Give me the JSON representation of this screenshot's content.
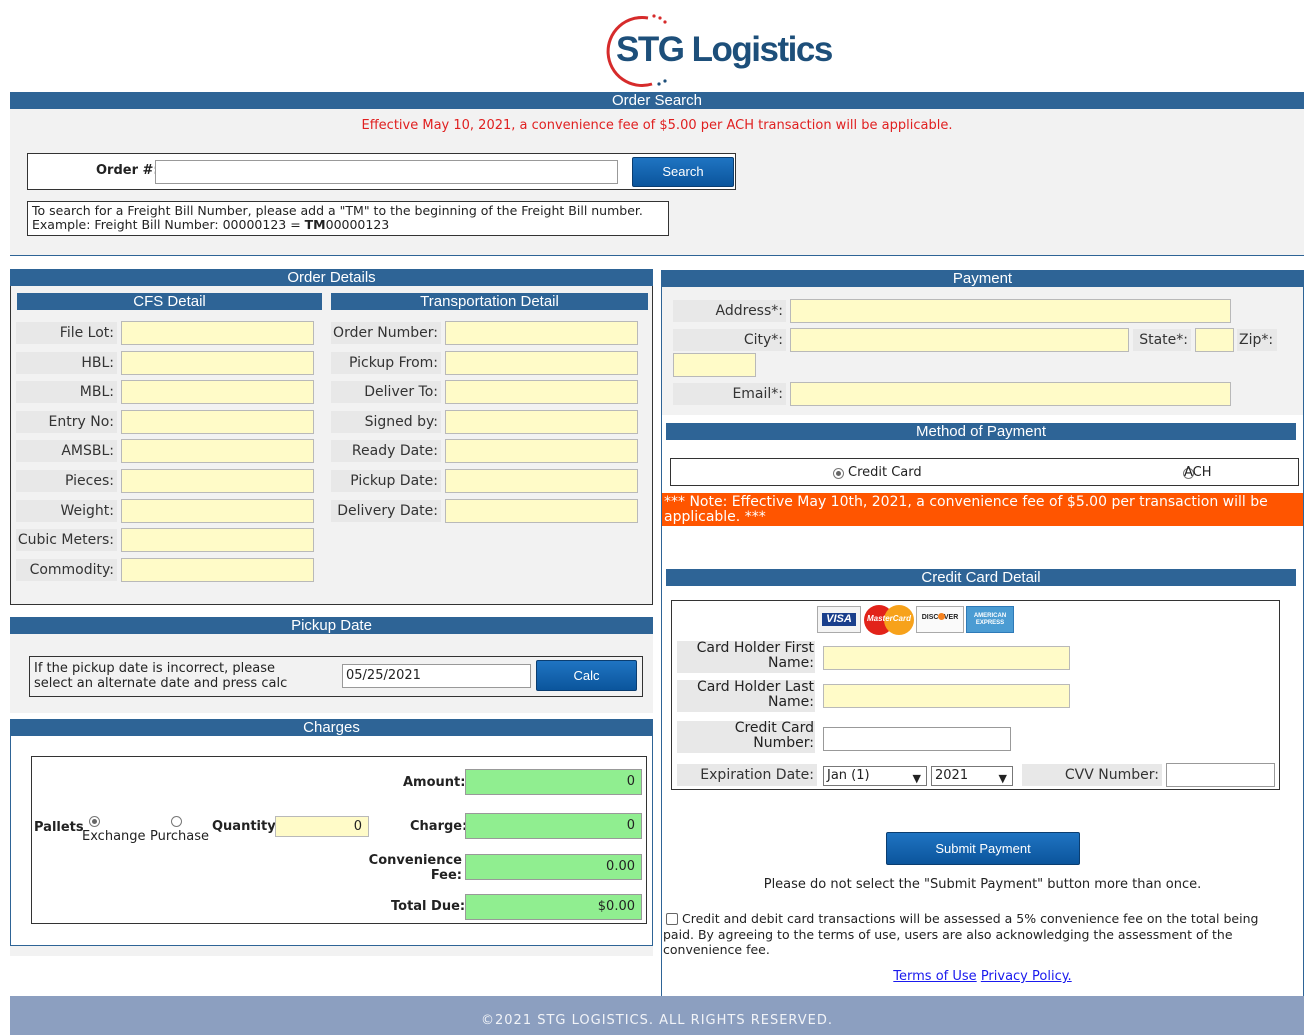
{
  "brand": {
    "logo_text": "STG Logistics"
  },
  "order_search": {
    "title": "Order Search",
    "notice": "Effective May 10, 2021, a convenience fee of $5.00 per ACH transaction will be applicable.",
    "order_label": "Order #:",
    "order_value": "",
    "search_label": "Search",
    "help_line1": "To search for a Freight Bill Number, please add a \"TM\" to the beginning of the Freight Bill number.",
    "help_line2_prefix": "Example: Freight Bill Number: 00000123 = ",
    "help_line2_bold": "TM",
    "help_line2_suffix": "00000123"
  },
  "order_details": {
    "title": "Order Details",
    "cfs": {
      "title": "CFS Detail",
      "fields": [
        "File Lot:",
        "HBL:",
        "MBL:",
        "Entry No:",
        "AMSBL:",
        "Pieces:",
        "Weight:",
        "Cubic Meters:",
        "Commodity:"
      ]
    },
    "transport": {
      "title": "Transportation Detail",
      "fields": [
        "Order Number:",
        "Pickup From:",
        "Deliver To:",
        "Signed by:",
        "Ready Date:",
        "Pickup Date:",
        "Delivery Date:"
      ]
    }
  },
  "pickup": {
    "title": "Pickup Date",
    "text_line1": "If the pickup date is incorrect, please",
    "text_line2": "select an alternate date and press calc",
    "date_value": "05/25/2021",
    "calc_label": "Calc"
  },
  "charges": {
    "title": "Charges",
    "pallets_label": "Pallets",
    "exchange_label": "Exchange",
    "purchase_label": "Purchase",
    "quantity_label": "Quantity",
    "quantity_value": "0",
    "amount_label": "Amount:",
    "amount_value": "0",
    "charge_label": "Charge:",
    "charge_value": "0",
    "conv_label_1": "Convenience",
    "conv_label_2": "Fee:",
    "conv_value": "0.00",
    "total_label": "Total Due:",
    "total_value": "$0.00"
  },
  "payment": {
    "title": "Payment",
    "address_label": "Address*:",
    "city_label": "City*:",
    "state_label": "State*:",
    "zip_label": "Zip*:",
    "email_label": "Email*:",
    "method_title": "Method of Payment",
    "credit_card_label": "Credit Card",
    "ach_label": "ACH",
    "note": "*** Note: Effective May 10th, 2021, a convenience fee of $5.00 per transaction will be applicable. ***",
    "cc_title": "Credit Card Detail",
    "cards": [
      "VISA",
      "MasterCard",
      "DISCOVER",
      "AMERICAN EXPRESS"
    ],
    "first_name_label_1": "Card Holder First",
    "first_name_label_2": "Name:",
    "last_name_label_1": "Card Holder Last",
    "last_name_label_2": "Name:",
    "cc_number_label_1": "Credit Card",
    "cc_number_label_2": "Number:",
    "exp_label": "Expiration Date:",
    "exp_month": "Jan (1)",
    "exp_year": "2021",
    "cvv_label": "CVV Number:",
    "submit_label": "Submit Payment",
    "submit_warning": "Please do not select the \"Submit Payment\" button more than once.",
    "terms_text": "Credit and debit card transactions will be assessed a 5% convenience fee on the total being paid. By agreeing to the terms of use, users are also acknowledging the assessment of the convenience fee.",
    "terms_link": "Terms of Use",
    "privacy_link": "Privacy Policy."
  },
  "footer": {
    "text": "©2021 STG LOGISTICS. ALL RIGHTS RESERVED."
  },
  "colors": {
    "header_bar": "#2e6496",
    "input_yellow": "#fffbc8",
    "input_green": "#90ee90",
    "note_bg": "#ff5500",
    "footer_bg": "#8c9fc0"
  }
}
